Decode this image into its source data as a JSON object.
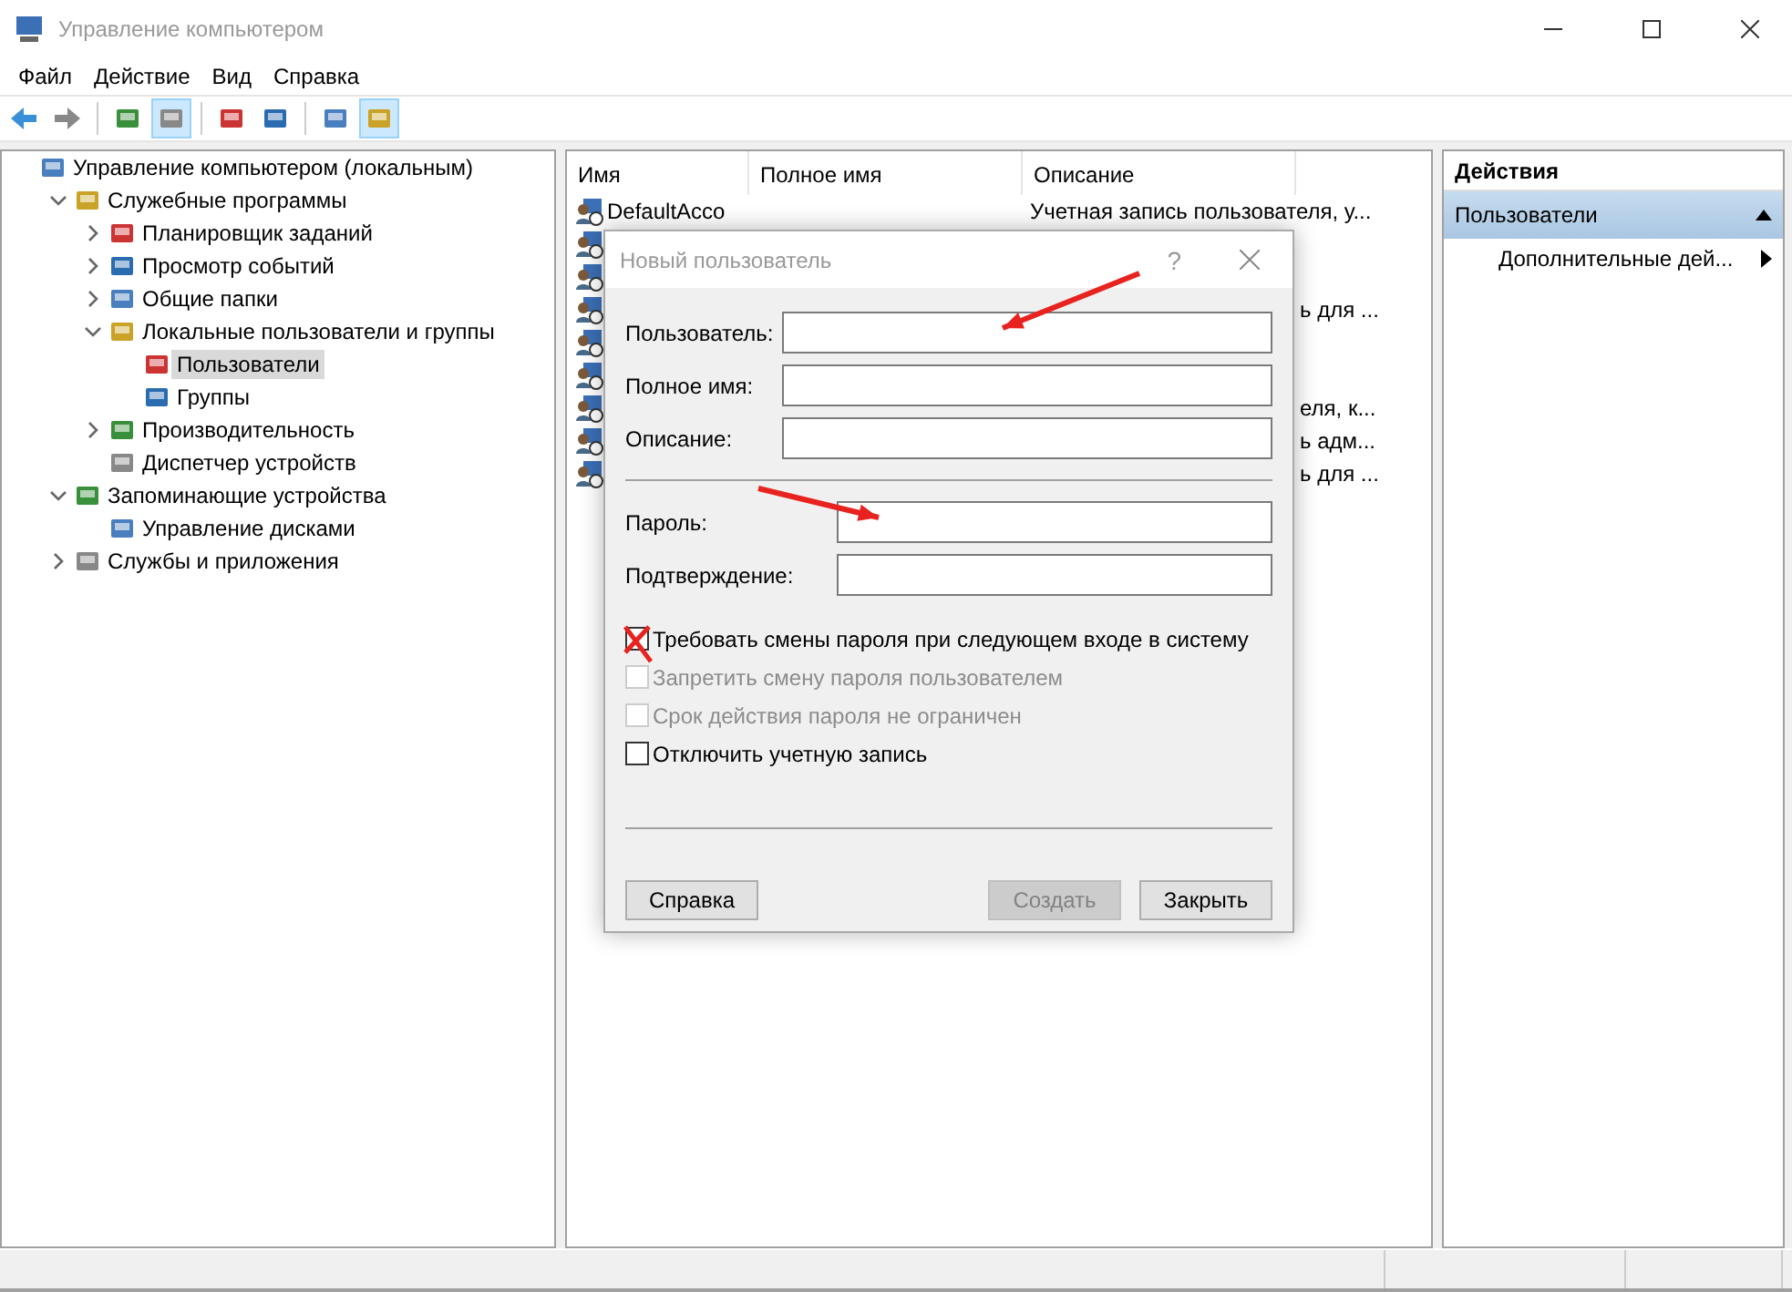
{
  "window": {
    "title": "Управление компьютером"
  },
  "menu": [
    "Файл",
    "Действие",
    "Вид",
    "Справка"
  ],
  "toolbar": [
    {
      "pressed": false
    },
    {
      "pressed": false
    },
    {
      "pressed": false
    },
    {
      "pressed": true
    },
    {
      "pressed": false
    },
    {
      "pressed": false
    },
    {
      "pressed": false
    },
    {
      "pressed": true
    }
  ],
  "tree": [
    {
      "label": "Управление компьютером (локальным)",
      "selected": false,
      "children": [
        {
          "label": "Служебные программы",
          "selected": false,
          "expanded": true,
          "children": [
            {
              "label": "Планировщик заданий",
              "selected": false,
              "expanded": false
            },
            {
              "label": "Просмотр событий",
              "selected": false,
              "expanded": false
            },
            {
              "label": "Общие папки",
              "selected": false,
              "expanded": false
            },
            {
              "label": "Локальные пользователи и группы",
              "selected": false,
              "expanded": true,
              "children": [
                {
                  "label": "Пользователи",
                  "selected": true
                },
                {
                  "label": "Группы",
                  "selected": false
                }
              ]
            },
            {
              "label": "Производительность",
              "selected": false,
              "expanded": false
            },
            {
              "label": "Диспетчер устройств",
              "selected": false
            }
          ]
        },
        {
          "label": "Запоминающие устройства",
          "selected": false,
          "expanded": true,
          "children": [
            {
              "label": "Управление дисками",
              "selected": false
            }
          ]
        },
        {
          "label": "Службы и приложения",
          "selected": false,
          "expanded": false
        }
      ]
    }
  ],
  "list": {
    "columns": [
      "Имя",
      "Полное имя",
      "Описание"
    ],
    "rows": [
      {
        "name": "DefaultAcco",
        "description": "Учетная запись пользователя, у..."
      },
      {},
      {},
      {
        "description_tail": "ь для ..."
      },
      {},
      {},
      {
        "description_tail": "еля, к..."
      },
      {
        "description_tail": "ь адм..."
      },
      {
        "description_tail": "ь для ..."
      }
    ]
  },
  "actions": {
    "title": "Действия",
    "section": "Пользователи",
    "items": [
      "Дополнительные дей..."
    ]
  },
  "dialog": {
    "title": "Новый пользователь",
    "help": "?",
    "fields": [
      {
        "label": "Пользователь:",
        "kind": "account"
      },
      {
        "label": "Полное имя:",
        "kind": "account"
      },
      {
        "label": "Описание:",
        "kind": "account"
      },
      {
        "label": "Пароль:",
        "kind": "password"
      },
      {
        "label": "Подтверждение:",
        "kind": "password"
      }
    ],
    "checkboxes": [
      {
        "label": "Требовать смены пароля при следующем входе в систему",
        "checked": false,
        "disabled": false
      },
      {
        "label": "Запретить смену пароля пользователем",
        "checked": false,
        "disabled": true
      },
      {
        "label": "Срок действия пароля не ограничен",
        "checked": false,
        "disabled": true
      },
      {
        "label": "Отключить учетную запись",
        "checked": false,
        "disabled": false
      }
    ],
    "buttons": [
      {
        "label": "Справка",
        "disabled": false
      },
      {
        "label": "Создать",
        "disabled": true
      },
      {
        "label": "Закрыть",
        "disabled": false
      }
    ]
  },
  "annotations": [
    {
      "kind": "arrow"
    },
    {
      "kind": "arrow"
    },
    {
      "kind": "cross"
    }
  ]
}
